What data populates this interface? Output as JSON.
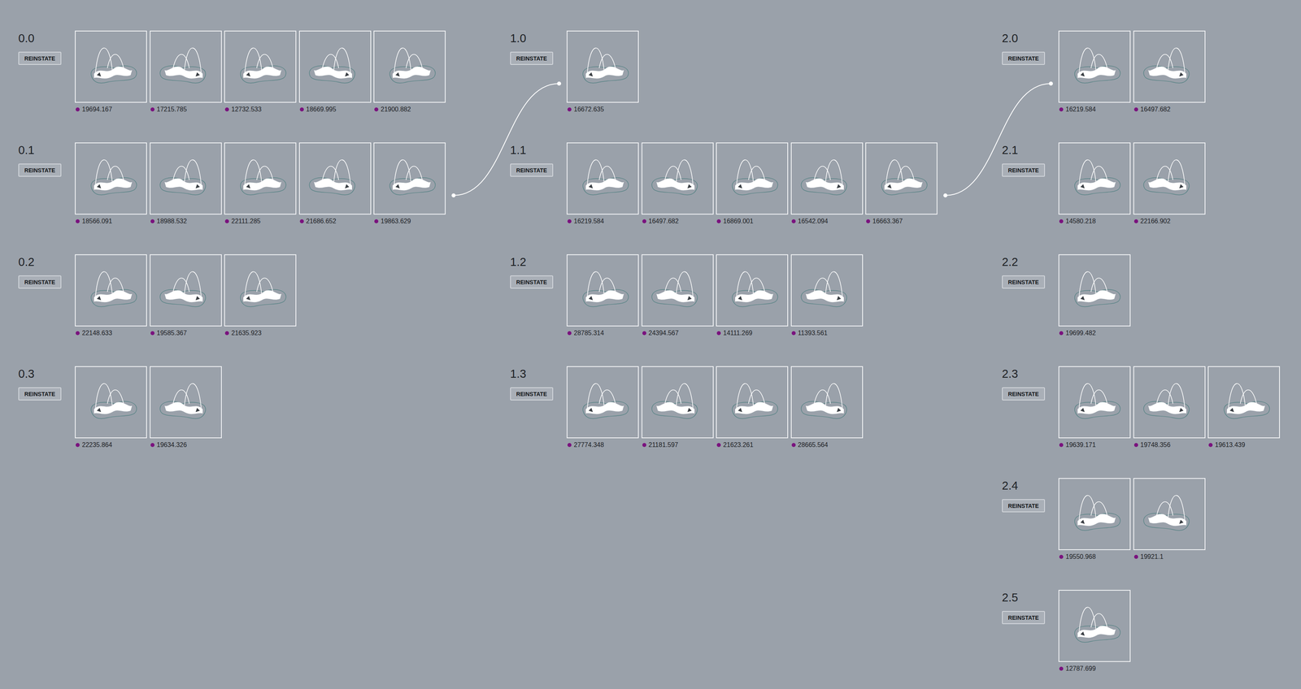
{
  "columns": [
    {
      "groups": [
        {
          "label": "0.0",
          "button": "REINSTATE",
          "designs": [
            {
              "value": "19694.167"
            },
            {
              "value": "17215.785"
            },
            {
              "value": "12732.533"
            },
            {
              "value": "18669.995"
            },
            {
              "value": "21900.882"
            }
          ]
        },
        {
          "label": "0.1",
          "button": "REINSTATE",
          "designs": [
            {
              "value": "18566.091"
            },
            {
              "value": "18988.532"
            },
            {
              "value": "22111.285"
            },
            {
              "value": "21686.652"
            },
            {
              "value": "19863.629"
            }
          ]
        },
        {
          "label": "0.2",
          "button": "REINSTATE",
          "designs": [
            {
              "value": "22148.633"
            },
            {
              "value": "19585.367"
            },
            {
              "value": "21635.923"
            }
          ]
        },
        {
          "label": "0.3",
          "button": "REINSTATE",
          "designs": [
            {
              "value": "22235.864"
            },
            {
              "value": "19634.326"
            }
          ]
        }
      ]
    },
    {
      "groups": [
        {
          "label": "1.0",
          "button": "REINSTATE",
          "designs": [
            {
              "value": "16672.635"
            }
          ]
        },
        {
          "label": "1.1",
          "button": "REINSTATE",
          "designs": [
            {
              "value": "16219.584"
            },
            {
              "value": "16497.682"
            },
            {
              "value": "16869.001"
            },
            {
              "value": "16542.094"
            },
            {
              "value": "16663.367"
            }
          ]
        },
        {
          "label": "1.2",
          "button": "REINSTATE",
          "designs": [
            {
              "value": "28785.314"
            },
            {
              "value": "24394.567"
            },
            {
              "value": "14111.269"
            },
            {
              "value": "11393.561"
            }
          ]
        },
        {
          "label": "1.3",
          "button": "REINSTATE",
          "designs": [
            {
              "value": "27774.348"
            },
            {
              "value": "21181.597"
            },
            {
              "value": "21623.261"
            },
            {
              "value": "28665.564"
            }
          ]
        }
      ]
    },
    {
      "groups": [
        {
          "label": "2.0",
          "button": "REINSTATE",
          "designs": [
            {
              "value": "16219.584"
            },
            {
              "value": "16497.682"
            }
          ]
        },
        {
          "label": "2.1",
          "button": "REINSTATE",
          "designs": [
            {
              "value": "14580.218"
            },
            {
              "value": "22166.902"
            }
          ]
        },
        {
          "label": "2.2",
          "button": "REINSTATE",
          "designs": [
            {
              "value": "19699.482"
            }
          ]
        },
        {
          "label": "2.3",
          "button": "REINSTATE",
          "designs": [
            {
              "value": "19639.171"
            },
            {
              "value": "19748.356"
            },
            {
              "value": "19613.439"
            }
          ]
        },
        {
          "label": "2.4",
          "button": "REINSTATE",
          "designs": [
            {
              "value": "19550.968"
            },
            {
              "value": "19921.1"
            }
          ]
        },
        {
          "label": "2.5",
          "button": "REINSTATE",
          "designs": [
            {
              "value": "12787.699"
            }
          ]
        }
      ]
    }
  ],
  "links": [
    {
      "from": "0.1",
      "to": "1.0"
    },
    {
      "from": "1.1",
      "to": "2.0"
    }
  ]
}
